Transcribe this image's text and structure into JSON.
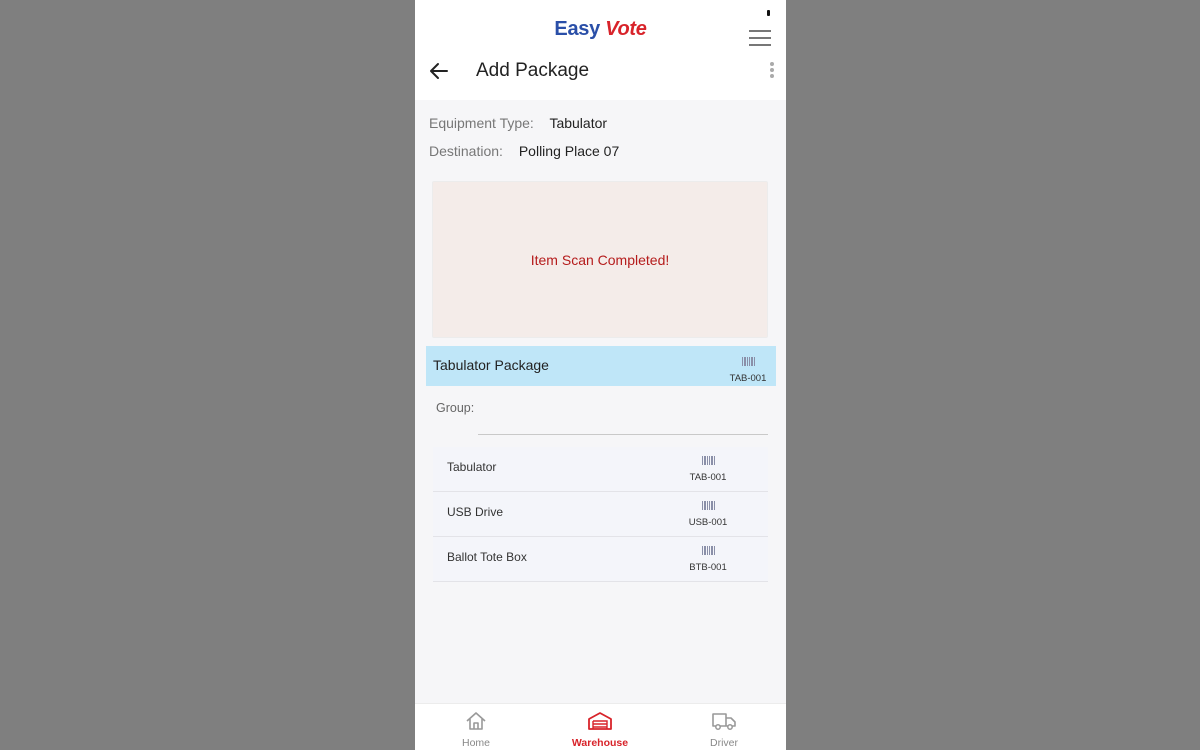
{
  "app": {
    "logo_part1": "Easy",
    "logo_part2": "Vote",
    "brand_blue": "#2a4fa8",
    "brand_red": "#d8232a"
  },
  "header": {
    "title": "Add Package",
    "back_icon": "arrow-left-icon",
    "menu_icon": "hamburger-menu-icon",
    "more_icon": "kebab-menu-icon"
  },
  "details": {
    "equipment_label": "Equipment Type:",
    "equipment_value": "Tabulator",
    "destination_label": "Destination:",
    "destination_value": "Polling Place 07"
  },
  "scan": {
    "message": "Item Scan Completed!",
    "message_color": "#b51c1c"
  },
  "package": {
    "name": "Tabulator Package",
    "code": "TAB-001",
    "highlight_color": "#bfe6f8"
  },
  "group": {
    "label": "Group:",
    "value": ""
  },
  "items": [
    {
      "name": "Tabulator",
      "code": "TAB-001"
    },
    {
      "name": "USB Drive",
      "code": "USB-001"
    },
    {
      "name": "Ballot Tote Box",
      "code": "BTB-001"
    }
  ],
  "bottom_nav": {
    "home": "Home",
    "warehouse": "Warehouse",
    "driver": "Driver",
    "active": "warehouse"
  }
}
